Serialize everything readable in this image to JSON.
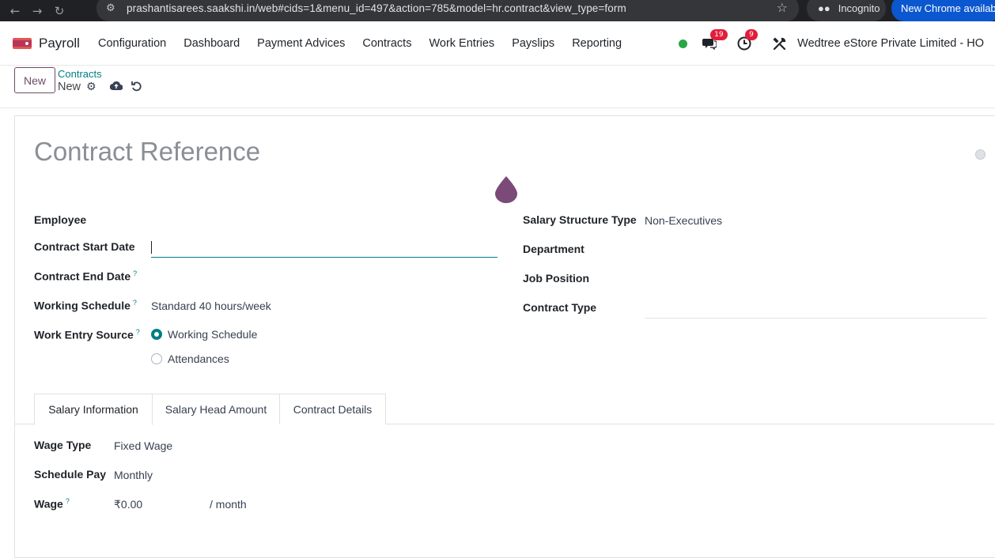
{
  "browser": {
    "url": "prashantisarees.saakshi.in/web#cids=1&menu_id=497&action=785&model=hr.contract&view_type=form",
    "incognito_label": "Incognito",
    "new_chrome_label": "New Chrome availab"
  },
  "nav": {
    "app_name": "Payroll",
    "menu": [
      "Configuration",
      "Dashboard",
      "Payment Advices",
      "Contracts",
      "Work Entries",
      "Payslips",
      "Reporting"
    ],
    "messages_count": "19",
    "activities_count": "9",
    "company": "Wedtree eStore Private Limited - HO"
  },
  "control_panel": {
    "new_label": "New",
    "breadcrumb_parent": "Contracts",
    "breadcrumb_current": "New"
  },
  "form": {
    "title_placeholder": "Contract Reference",
    "left": {
      "employee_label": "Employee",
      "start_date_label": "Contract Start Date",
      "end_date_label": "Contract End Date",
      "working_schedule_label": "Working Schedule",
      "working_schedule_value": "Standard 40 hours/week",
      "work_entry_source_label": "Work Entry Source",
      "work_entry_options": [
        "Working Schedule",
        "Attendances"
      ],
      "work_entry_selected": "Working Schedule"
    },
    "right": {
      "salary_structure_label": "Salary Structure Type",
      "salary_structure_value": "Non-Executives",
      "department_label": "Department",
      "job_position_label": "Job Position",
      "contract_type_label": "Contract Type"
    },
    "help_mark": "?",
    "tabs": [
      "Salary Information",
      "Salary Head Amount",
      "Contract Details"
    ],
    "active_tab": "Salary Information",
    "salary": {
      "wage_type_label": "Wage Type",
      "wage_type_value": "Fixed Wage",
      "schedule_pay_label": "Schedule Pay",
      "schedule_pay_value": "Monthly",
      "wage_label": "Wage",
      "wage_value": "₹0.00",
      "wage_unit": "/ month"
    }
  },
  "colors": {
    "primary": "#714b67",
    "accent": "#017e84",
    "badge": "#e21d3a",
    "presence": "#28a745"
  }
}
